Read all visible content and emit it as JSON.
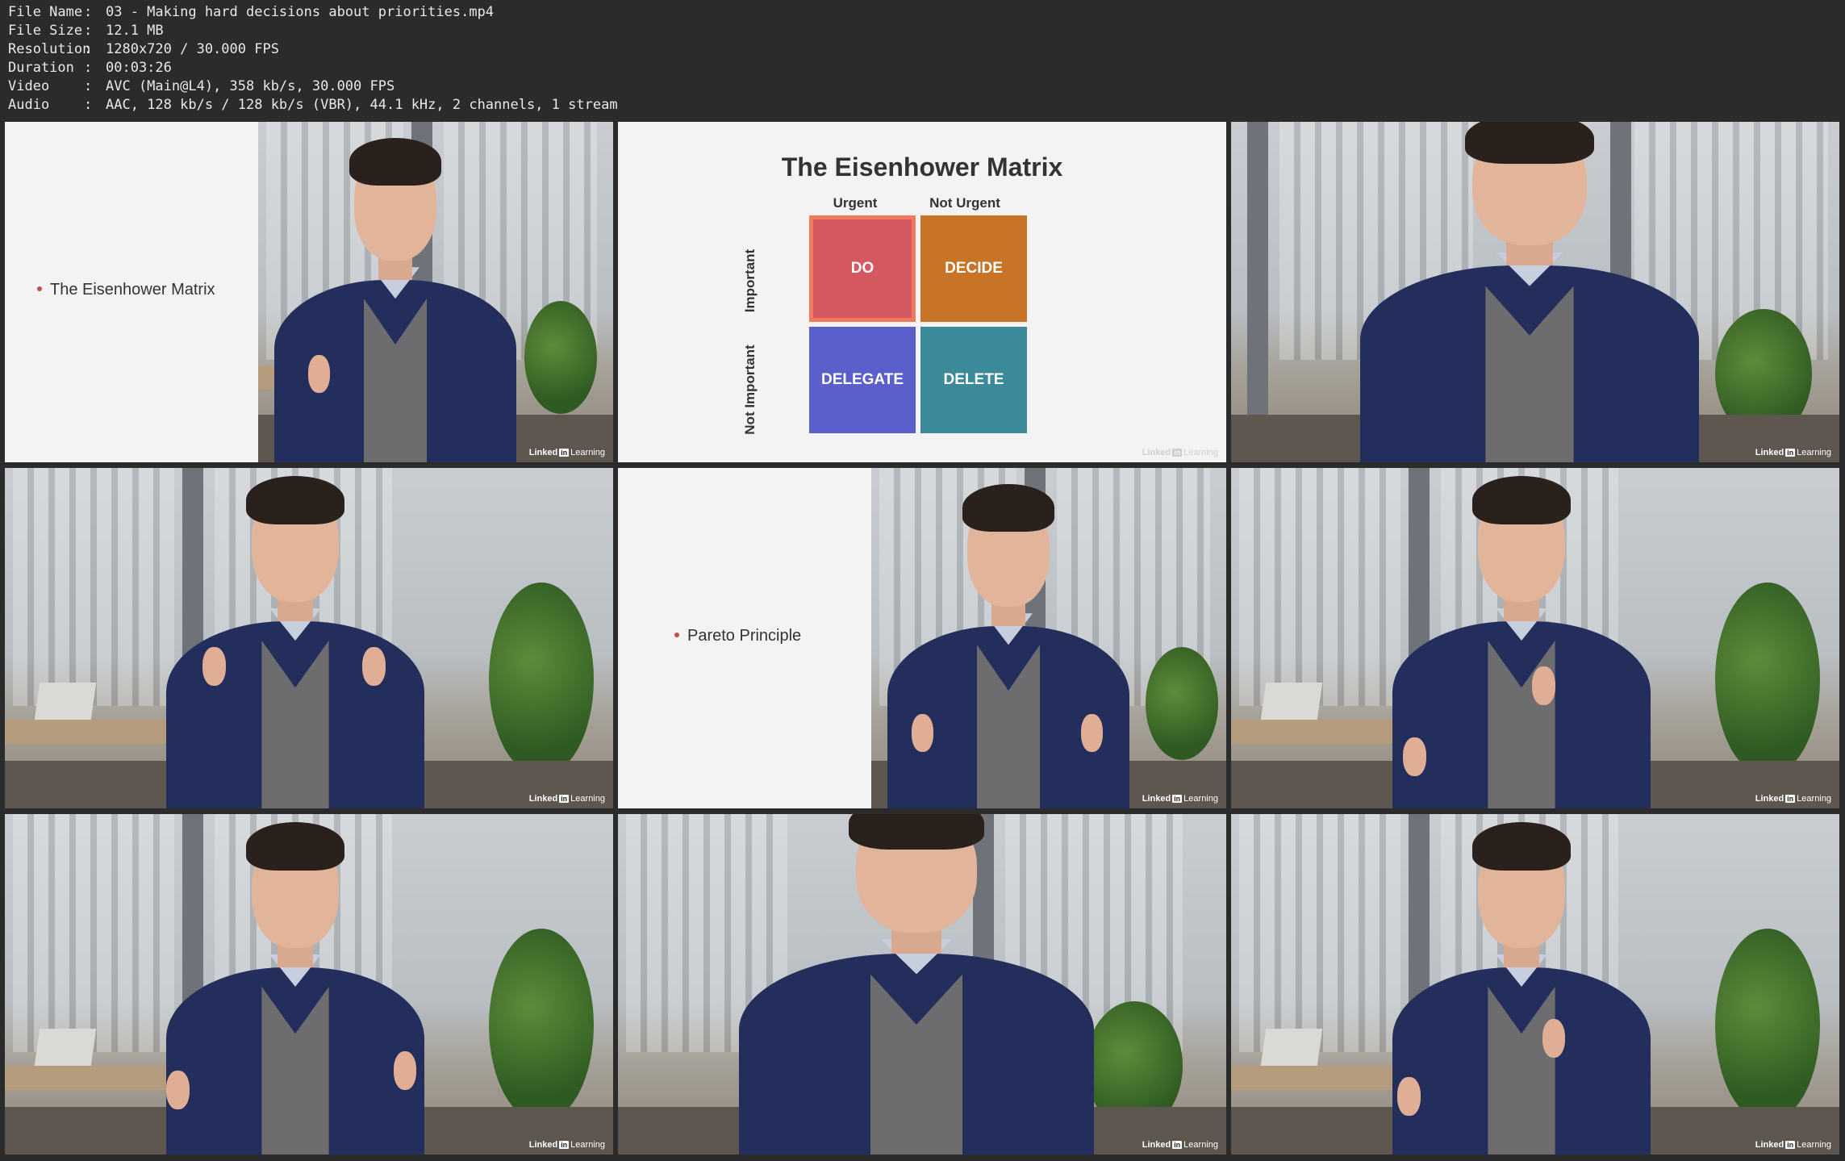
{
  "info": {
    "rows": [
      {
        "label": "File Name",
        "value": "03 - Making hard decisions about priorities.mp4"
      },
      {
        "label": "File Size",
        "value": "12.1 MB"
      },
      {
        "label": "Resolution",
        "value": "1280x720 / 30.000 FPS"
      },
      {
        "label": "Duration",
        "value": "00:03:26"
      },
      {
        "label": "Video",
        "value": "AVC (Main@L4), 358 kb/s, 30.000 FPS"
      },
      {
        "label": "Audio",
        "value": "AAC, 128 kb/s / 128 kb/s (VBR), 44.1 kHz, 2 channels, 1 stream"
      }
    ],
    "separator": ":"
  },
  "thumbnails": {
    "bullet_1": "The Eisenhower Matrix",
    "bullet_2": "Pareto Principle",
    "watermark_brand": "Linked",
    "watermark_in": "in",
    "watermark_suffix": "Learning"
  },
  "matrix": {
    "title": "The Eisenhower Matrix",
    "col_urgent": "Urgent",
    "col_not_urgent": "Not Urgent",
    "row_important": "Important",
    "row_not_important": "Not Important",
    "do": "DO",
    "decide": "DECIDE",
    "delegate": "DELEGATE",
    "delete": "DELETE",
    "colors": {
      "do": "#d4585f",
      "do_border": "#f0795f",
      "decide": "#c77427",
      "delegate": "#5a5fcb",
      "delete": "#3b8a9a"
    }
  }
}
